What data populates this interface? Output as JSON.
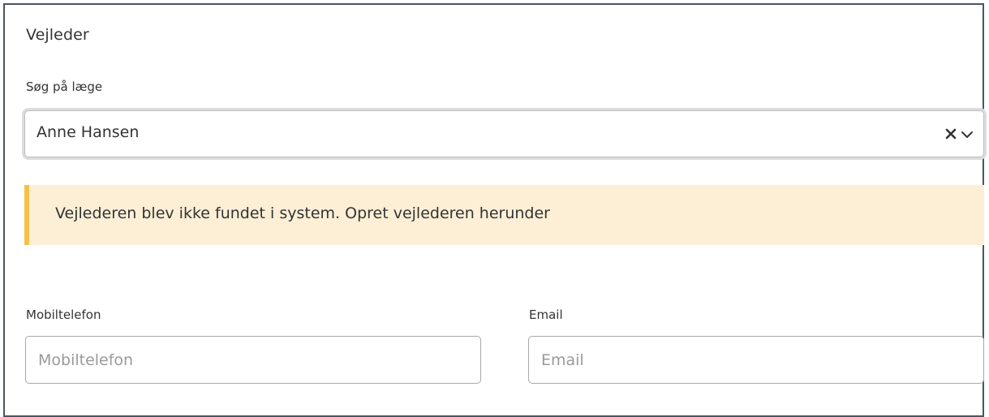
{
  "section": {
    "title": "Vejleder"
  },
  "search": {
    "label": "Søg på læge",
    "selected_value": "Anne Hansen",
    "clear_icon": "close-icon",
    "dropdown_icon": "chevron-down-icon"
  },
  "alert": {
    "message": "Vejlederen blev ikke fundet i system. Opret vejlederen herunder",
    "accent_color": "#f5c04a",
    "background_color": "#fcefd6"
  },
  "form": {
    "mobile": {
      "label": "Mobiltelefon",
      "placeholder": "Mobiltelefon",
      "value": ""
    },
    "email": {
      "label": "Email",
      "placeholder": "Email",
      "value": ""
    }
  }
}
